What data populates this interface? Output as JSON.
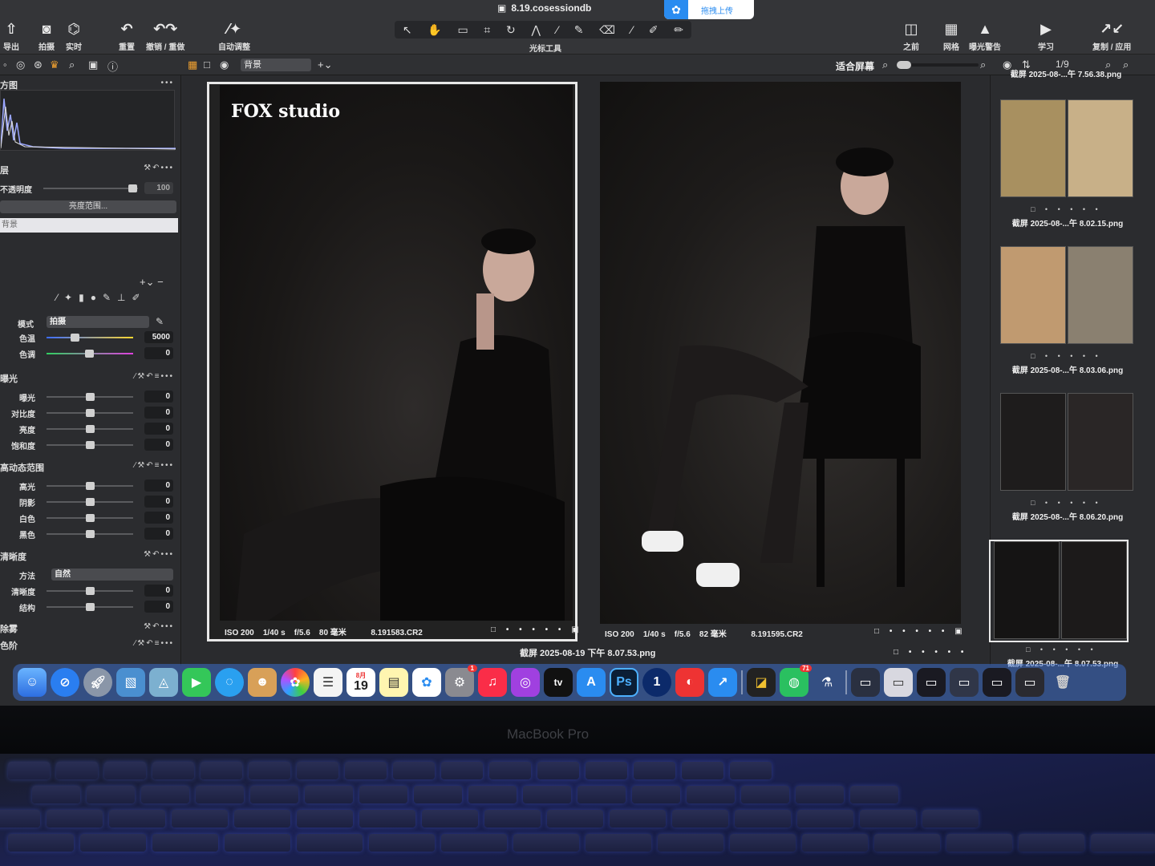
{
  "window": {
    "title": "8.19.cosessiondb"
  },
  "upload_widget": {
    "label": "拖拽上传"
  },
  "toolbar": {
    "export": "导出",
    "capture": "拍摄",
    "live": "实时",
    "reset": "重置",
    "undo_redo": "撤销 / 重做",
    "auto_adjust": "自动调整",
    "cursor_tools": "光标工具",
    "before": "之前",
    "grid": "网格",
    "exposure_warning": "曝光警告",
    "learn": "学习",
    "copy_apply": "复制 / 应用"
  },
  "bar2": {
    "layer_select": "背景",
    "fit_screen": "适合屏幕",
    "page_count": "1/9"
  },
  "left_panel": {
    "histogram_title": "方图",
    "layers_title": "层",
    "opacity_label": "不透明度",
    "opacity_value": "100",
    "brightness_range": "亮度范围...",
    "layer_background": "背景",
    "wb": {
      "mode_label": "模式",
      "mode_value": "拍摄",
      "temp_label": "色温",
      "temp_value": "5000",
      "tint_label": "色调",
      "tint_value": "0"
    },
    "exposure": {
      "title": "曝光",
      "rows": [
        {
          "label": "曝光",
          "value": "0",
          "pos": 0.5
        },
        {
          "label": "对比度",
          "value": "0",
          "pos": 0.5
        },
        {
          "label": "亮度",
          "value": "0",
          "pos": 0.5
        },
        {
          "label": "饱和度",
          "value": "0",
          "pos": 0.5
        }
      ]
    },
    "hdr": {
      "title": "高动态范围",
      "rows": [
        {
          "label": "高光",
          "value": "0",
          "pos": 0.5
        },
        {
          "label": "阴影",
          "value": "0",
          "pos": 0.5
        },
        {
          "label": "白色",
          "value": "0",
          "pos": 0.5
        },
        {
          "label": "黑色",
          "value": "0",
          "pos": 0.5
        }
      ]
    },
    "clarity": {
      "title": "清晰度",
      "method_label": "方法",
      "method_value": "自然",
      "rows": [
        {
          "label": "清晰度",
          "value": "0",
          "pos": 0.5
        },
        {
          "label": "结构",
          "value": "0",
          "pos": 0.5
        }
      ]
    },
    "dehaze_title": "除雾",
    "color_title": "色阶"
  },
  "viewer": {
    "watermark": "FOX studio",
    "left_meta": {
      "iso": "ISO 200",
      "shutter": "1/40 s",
      "aperture": "f/5.6",
      "focal": "80 毫米",
      "file": "8.191583.CR2"
    },
    "right_meta": {
      "iso": "ISO 200",
      "shutter": "1/40 s",
      "aperture": "f/5.6",
      "focal": "82 毫米",
      "file": "8.191595.CR2"
    },
    "caption": "截屏 2025-08-19 下午 8.07.53.png"
  },
  "filmstrip": {
    "top_cap": "截屏 2025-08-...午 7.56.38.png",
    "items": [
      {
        "caption": "截屏 2025-08-...午 8.02.15.png"
      },
      {
        "caption": "截屏 2025-08-...午 8.03.06.png"
      },
      {
        "caption": "截屏 2025-08-...午 8.06.20.png"
      },
      {
        "caption": "截屏 2025-08-...午 8.07.53.png"
      }
    ]
  },
  "dock": {
    "ps_label": "Ps",
    "calendar_day": "19",
    "calendar_month": "8月",
    "settings_badge": "1",
    "wechat_badge": "71"
  },
  "laptop": {
    "brand": "MacBook Pro"
  },
  "colors": {
    "accent": "#2a8cf0",
    "dock": "#3c6ec8"
  }
}
